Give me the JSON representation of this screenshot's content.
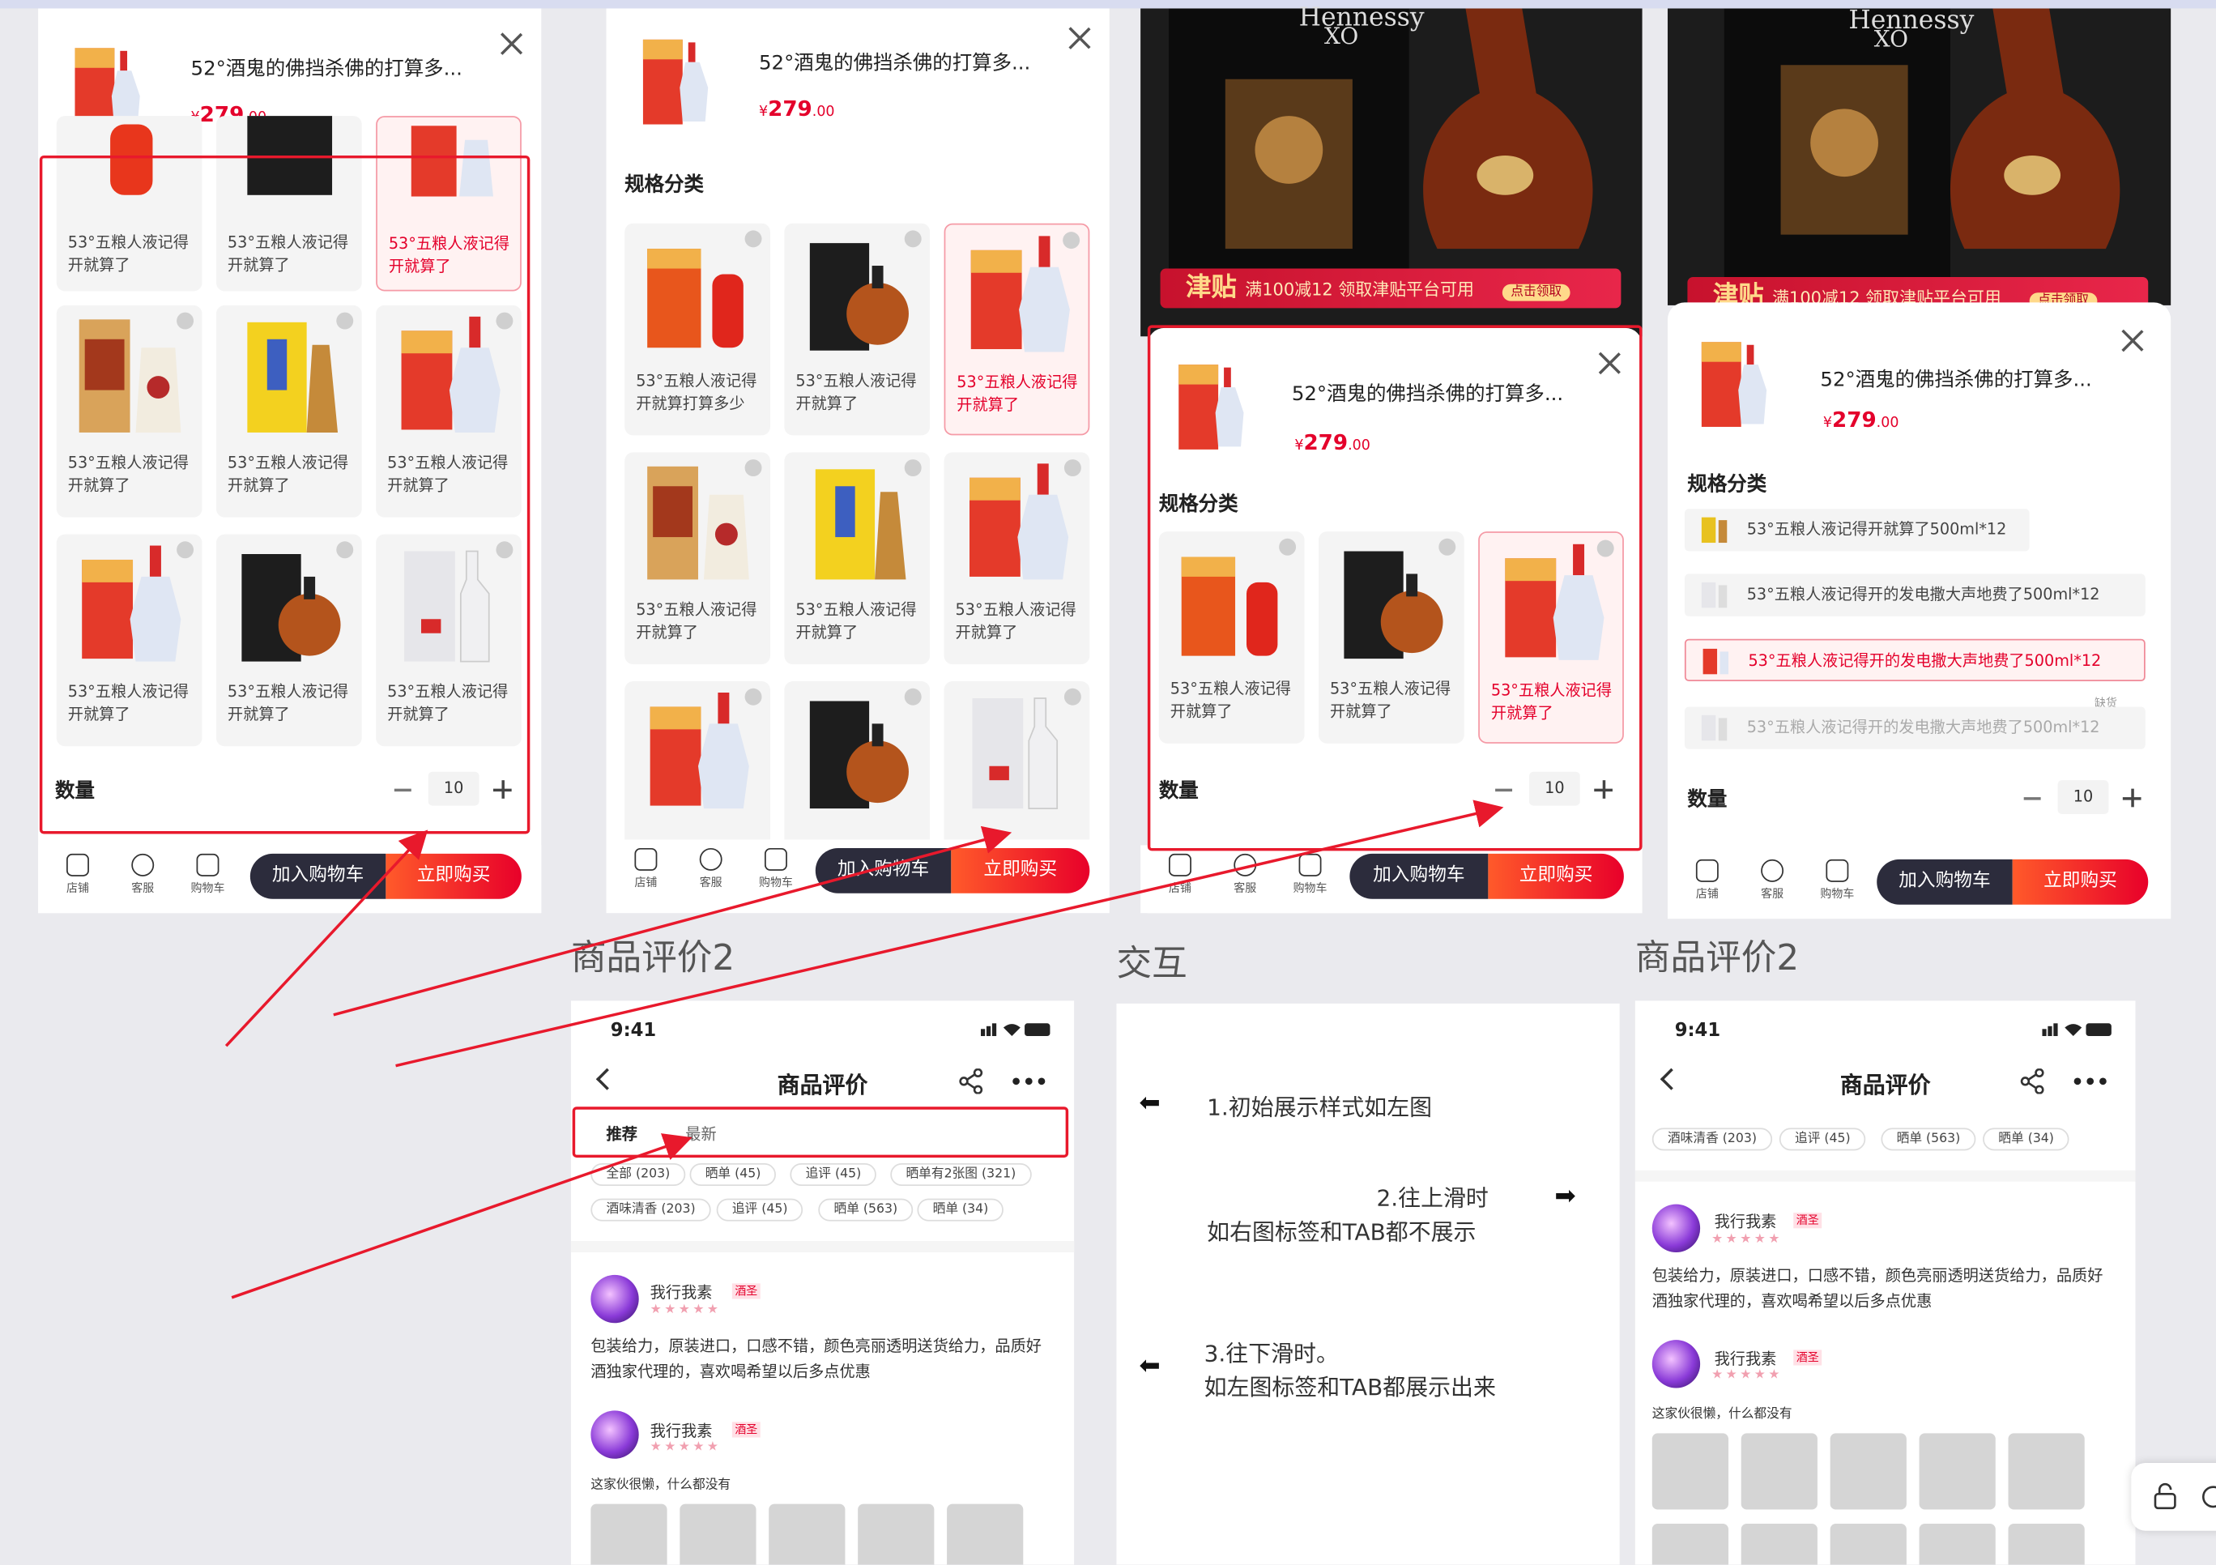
{
  "product": {
    "title": "52°酒鬼的佛挡杀佛的打算多...",
    "currency": "¥",
    "price_int": "279",
    "price_dec": ".00"
  },
  "labels": {
    "spec": "规格分类",
    "qty": "数量",
    "qty_value": "10",
    "store": "店铺",
    "service": "客服",
    "cart": "购物车",
    "add_cart": "加入购物车",
    "buy_now": "立即购买"
  },
  "cards": {
    "normal": "53°五粮人液记得开就算了",
    "extra": "53°五粮人液记得开就算打算多少"
  },
  "list_items": [
    "53°五粮人液记得开就算了500ml*12",
    "53°五粮人液记得开的发电撒大声地费了500ml*12",
    "53°五粮人液记得开的发电撒大声地费了500ml*12",
    "53°五粮人液记得开的发电撒大声地费了500ml*12"
  ],
  "list_badge": "缺货",
  "banner": {
    "brand": "Hennessy",
    "model": "XO",
    "tie": "津贴",
    "promo": "满100减12 领取津贴平台可用",
    "claim": "点击领取"
  },
  "captions": {
    "left": "商品评价2",
    "middle": "交互",
    "right": "商品评价2"
  },
  "review_page": {
    "time": "9:41",
    "title": "商品评价",
    "tabs": [
      "推荐",
      "最新"
    ],
    "chips_row1": [
      "全部 (203)",
      "晒单 (45)",
      "追评 (45)",
      "晒单有2张图 (321)"
    ],
    "chips_row2": [
      "酒味清香 (203)",
      "追评 (45)",
      "晒单 (563)",
      "晒单 (34)"
    ],
    "user": "我行我素",
    "user_tag": "酒圣",
    "stars": "★★★★★",
    "review1": "包装给力，原装进口，口感不错，颜色亮丽透明送货给力，品质好酒独家代理的，喜欢喝希望以后多点优惠",
    "review2": "这家伙很懒，什么都没有"
  },
  "interaction": {
    "s1": "1.初始展示样式如左图",
    "s2a": "2.往上滑时",
    "s2b": "如右图标签和TAB都不展示",
    "s3a": "3.往下滑时。",
    "s3b": "如左图标签和TAB都展示出来"
  },
  "icons": [
    "close-icon",
    "store-icon",
    "service-icon",
    "cart-icon",
    "back-icon",
    "share-icon",
    "more-icon",
    "lock-icon",
    "arrow-left-icon",
    "arrow-right-icon"
  ],
  "colors": {
    "accent": "#e4002b",
    "annotation": "#e8192c",
    "dark_button": "#2c2c3c"
  }
}
